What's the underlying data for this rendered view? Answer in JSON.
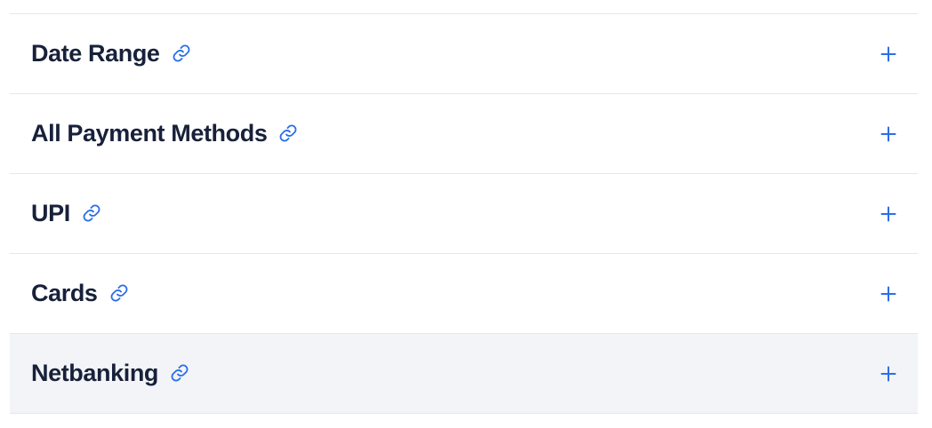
{
  "colors": {
    "title": "#18213a",
    "accent": "#2b6de8",
    "divider": "#e5e7eb",
    "active_row_bg": "#f3f4f7"
  },
  "accordion": {
    "items": [
      {
        "label": "Date Range",
        "link_icon": "link-icon",
        "toggle_icon": "plus-icon",
        "active": false
      },
      {
        "label": "All Payment Methods",
        "link_icon": "link-icon",
        "toggle_icon": "plus-icon",
        "active": false
      },
      {
        "label": "UPI",
        "link_icon": "link-icon",
        "toggle_icon": "plus-icon",
        "active": false
      },
      {
        "label": "Cards",
        "link_icon": "link-icon",
        "toggle_icon": "plus-icon",
        "active": false
      },
      {
        "label": "Netbanking",
        "link_icon": "link-icon",
        "toggle_icon": "plus-icon",
        "active": true
      }
    ]
  }
}
